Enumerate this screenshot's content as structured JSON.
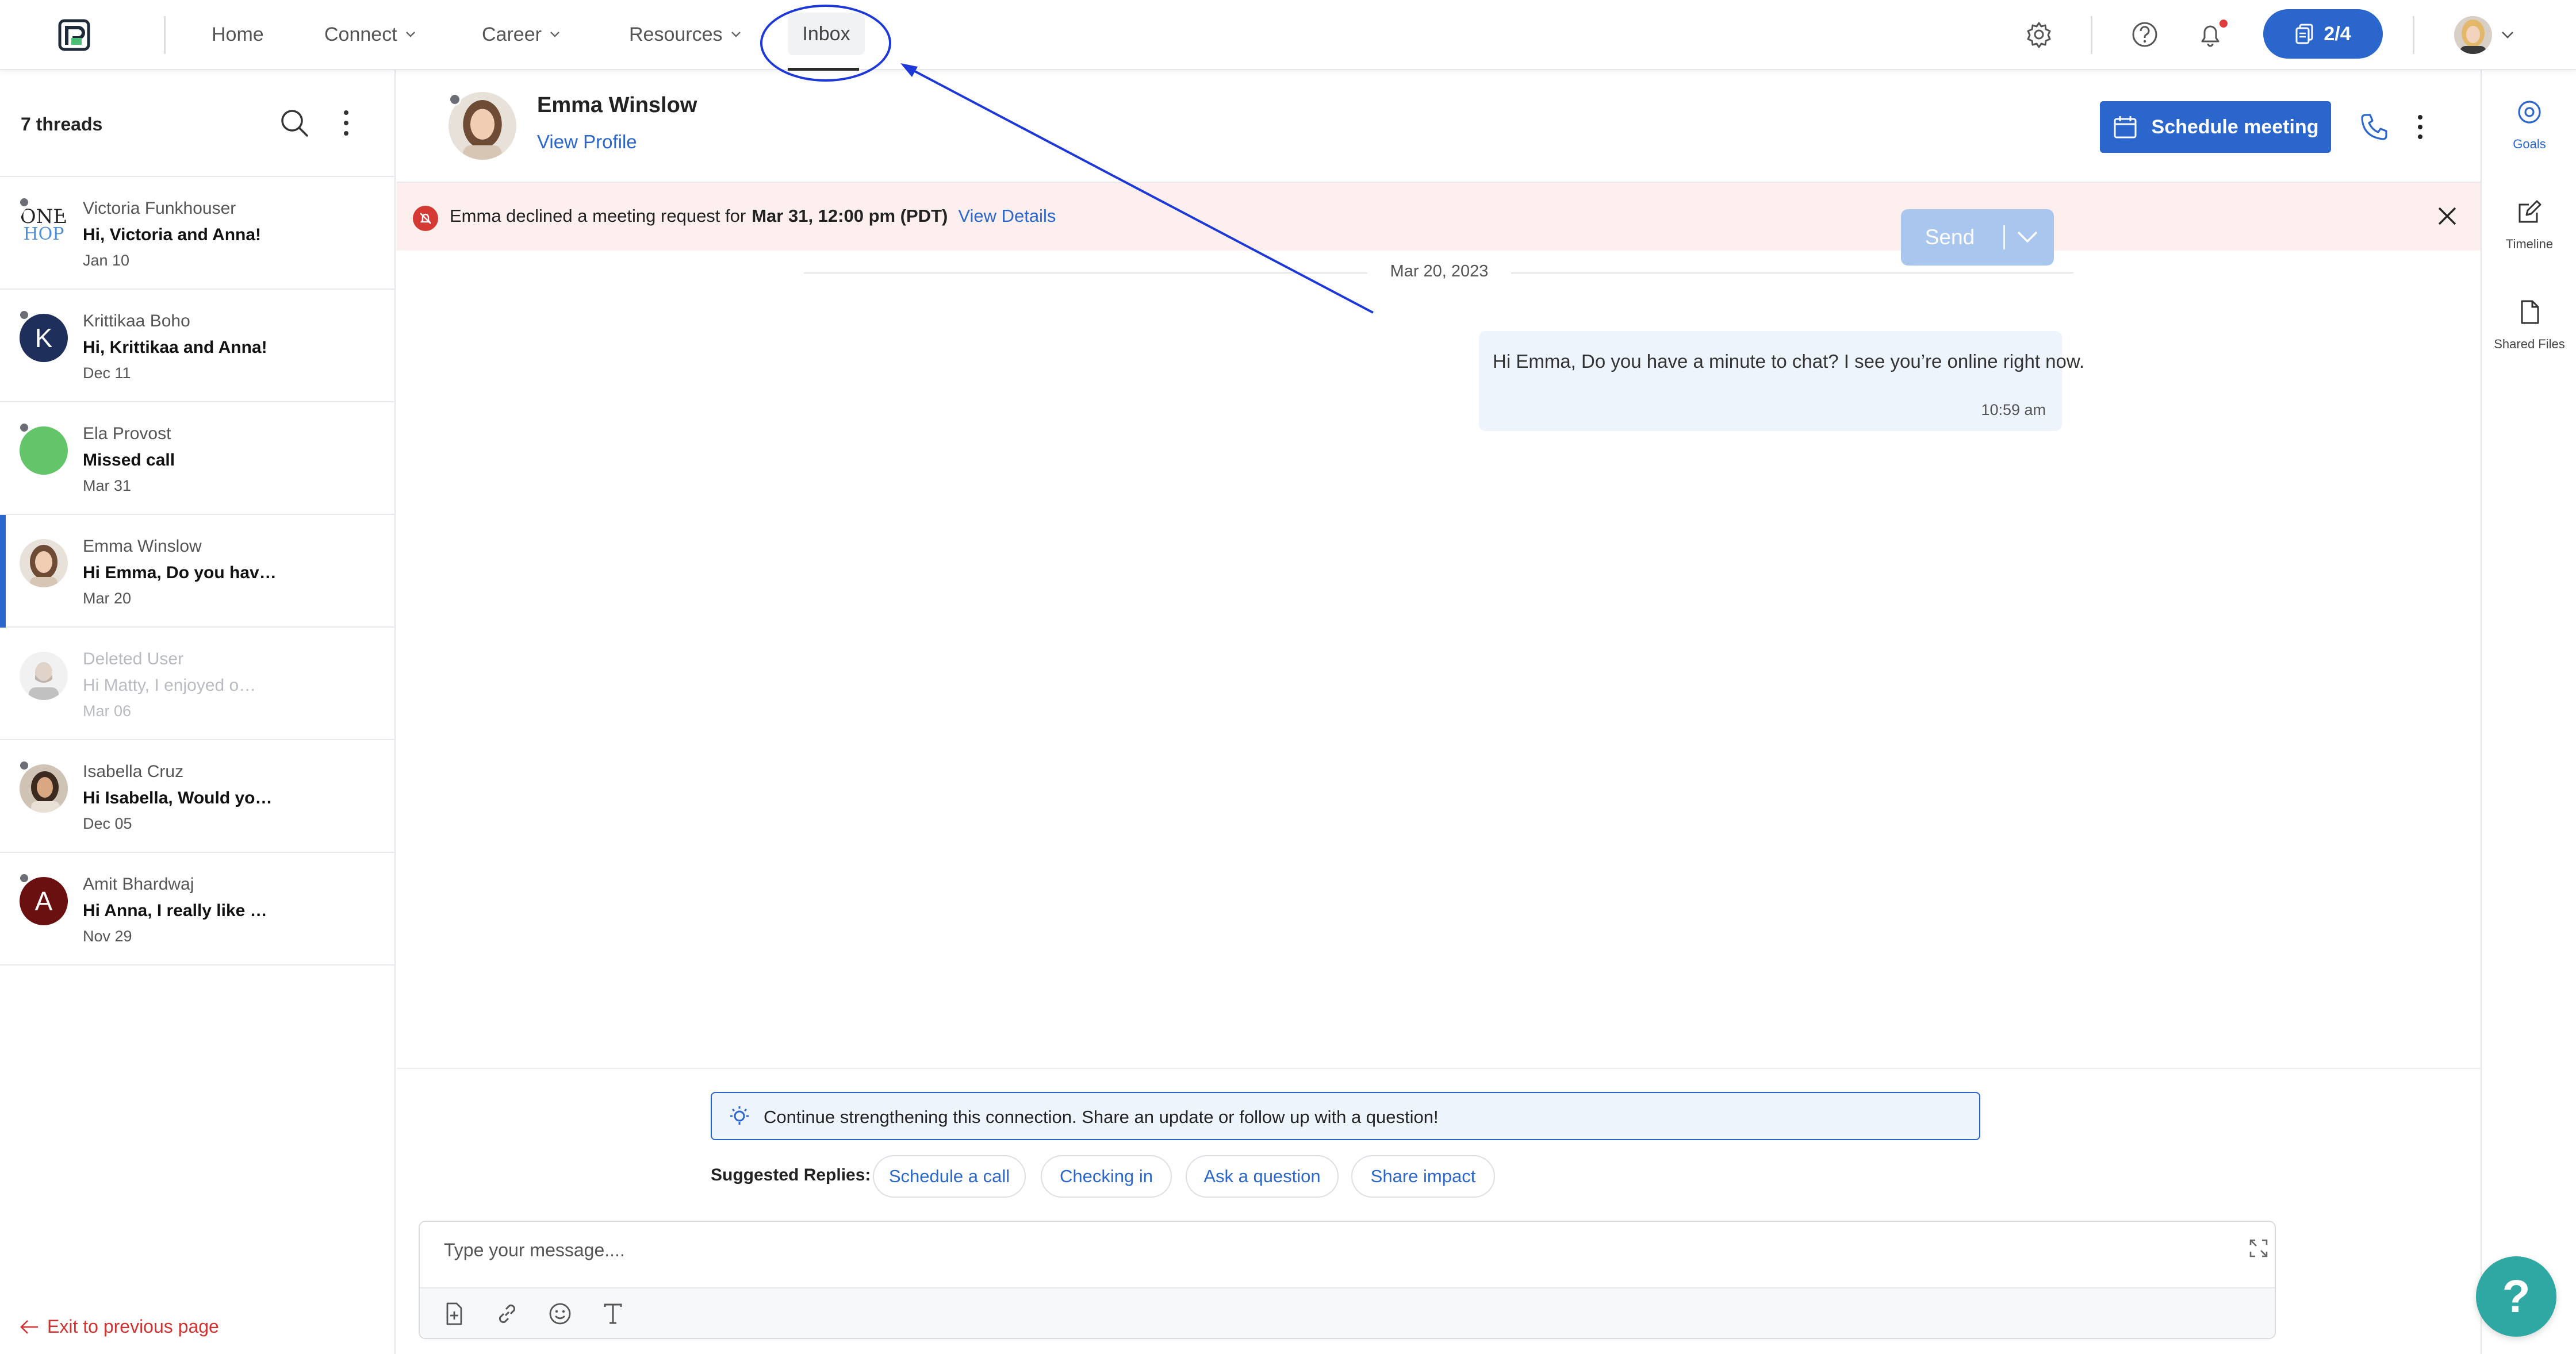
{
  "nav": {
    "items": [
      {
        "label": "Home"
      },
      {
        "label": "Connect"
      },
      {
        "label": "Career"
      },
      {
        "label": "Resources"
      }
    ],
    "active_tab": "Inbox",
    "progress_badge": "2/4",
    "brand_color": "#2a66cc"
  },
  "threads": {
    "count_label": "7 threads",
    "items": [
      {
        "name": "Victoria Funkhouser",
        "message": "Hi, Victoria and Anna!",
        "date": "Jan 10",
        "avatar": "logo",
        "avatar_logo_top": "ONE",
        "avatar_logo_bottom": "HOP"
      },
      {
        "name": "Krittikaa Boho",
        "message": "Hi, Krittikaa and Anna!",
        "date": "Dec 11",
        "avatar": "initial",
        "initial": "K",
        "avatar_color": "#1f2f5c"
      },
      {
        "name": "Ela Provost",
        "message": "Missed call",
        "date": "Mar 31",
        "avatar": "color",
        "avatar_color": "#63c46a"
      },
      {
        "name": "Emma Winslow",
        "message": "Hi Emma, Do you hav…",
        "date": "Mar 20",
        "avatar": "photo",
        "active": true
      },
      {
        "name": "Deleted User",
        "message": "Hi Matty,  I enjoyed o…",
        "date": "Mar 06",
        "avatar": "generic",
        "deleted": true
      },
      {
        "name": "Isabella Cruz",
        "message": "Hi Isabella, Would yo…",
        "date": "Dec 05",
        "avatar": "photo"
      },
      {
        "name": "Amit Bhardwaj",
        "message": "Hi Anna,  I really like …",
        "date": "Nov 29",
        "avatar": "initial",
        "initial": "A",
        "avatar_color": "#6b1010"
      }
    ]
  },
  "exit_label": "Exit to previous page",
  "conversation": {
    "name": "Emma Winslow",
    "view_profile": "View Profile",
    "schedule_label": "Schedule meeting",
    "banner": {
      "prefix": "Emma declined a meeting request for",
      "when": "Mar 31, 12:00 pm (PDT)",
      "link": "View Details"
    },
    "date_divider": "Mar 20, 2023",
    "messages": [
      {
        "text": "Hi Emma, Do you have a minute to chat? I see you’re online right now.",
        "time": "10:59 am"
      }
    ]
  },
  "composer": {
    "tip": "Continue strengthening this connection. Share an update or follow up with a question!",
    "suggest_label": "Suggested Replies:",
    "suggestions": [
      "Schedule a call",
      "Checking in",
      "Ask a question",
      "Share impact"
    ],
    "placeholder": "Type your message....",
    "send_label": "Send"
  },
  "rail": {
    "items": [
      {
        "label": "Goals",
        "icon": "target-icon",
        "active": true
      },
      {
        "label": "Timeline",
        "icon": "edit-icon"
      },
      {
        "label": "Shared Files",
        "icon": "file-icon"
      }
    ]
  },
  "help_label": "?"
}
